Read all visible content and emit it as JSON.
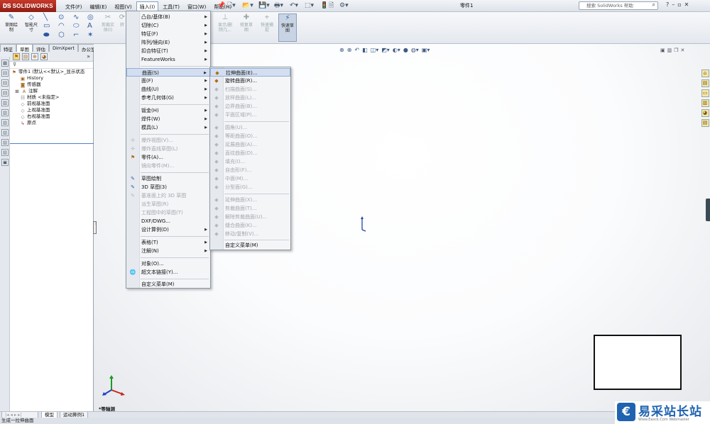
{
  "app": {
    "logo": "SOLIDWORKS",
    "document_title": "零件1"
  },
  "menubar": [
    "文件(F)",
    "编辑(E)",
    "视图(V)",
    "插入(I)",
    "工具(T)",
    "窗口(W)",
    "帮助(H)"
  ],
  "search": {
    "placeholder": "搜索 SolidWorks 帮助"
  },
  "cmd": {
    "sketch": "草图绘\n制",
    "smart_dim": "智能尺\n寸",
    "trim": "剪裁实\n体(I)",
    "convert": "转",
    "show_hide": "显示/删\n除几...",
    "repair": "修复草\n图",
    "quick_snap": "快速捕\n捉",
    "rapid_sketch": "快速草\n图"
  },
  "tabs": [
    "特征",
    "草图",
    "评估",
    "DimXpert",
    "办公室产品"
  ],
  "tree": {
    "root": "零件1 (默认<<默认>_显示状态",
    "items": [
      "History",
      "传感器",
      "注解",
      "材质 <未指定>",
      "前视基准面",
      "上视基准面",
      "右视基准面",
      "原点"
    ]
  },
  "insert_menu": [
    {
      "label": "凸台/基体(B)",
      "arrow": true
    },
    {
      "label": "切除(C)",
      "arrow": true
    },
    {
      "label": "特征(F)",
      "arrow": true
    },
    {
      "label": "阵列/镜向(E)",
      "arrow": true
    },
    {
      "label": "扣合特征(T)",
      "arrow": true
    },
    {
      "label": "FeatureWorks",
      "arrow": true
    },
    {
      "label": "曲面(S)",
      "arrow": true,
      "highlight": true
    },
    {
      "label": "面(F)",
      "arrow": true
    },
    {
      "label": "曲线(U)",
      "arrow": true
    },
    {
      "label": "参考几何体(G)",
      "arrow": true
    },
    {
      "label": "钣金(H)",
      "arrow": true
    },
    {
      "label": "焊件(W)",
      "arrow": true
    },
    {
      "label": "模具(L)",
      "arrow": true
    },
    {
      "label": "爆炸视图(V)...",
      "disabled": true
    },
    {
      "label": "爆炸直线草图(L)",
      "disabled": true
    },
    {
      "label": "零件(A)..."
    },
    {
      "label": "镜向零件(M)...",
      "disabled": true
    },
    {
      "label": "草图绘制"
    },
    {
      "label": "3D 草图(3)"
    },
    {
      "label": "基准面上的 3D 草图",
      "disabled": true
    },
    {
      "label": "派生草图(R)",
      "disabled": true
    },
    {
      "label": "工程图中的草图(T)",
      "disabled": true
    },
    {
      "label": "DXF/DWG..."
    },
    {
      "label": "设计算例(D)",
      "arrow": true
    },
    {
      "label": "表格(T)",
      "arrow": true
    },
    {
      "label": "注解(N)",
      "arrow": true
    },
    {
      "label": "对象(O)..."
    },
    {
      "label": "超文本链接(Y)..."
    },
    {
      "label": "自定义菜单(M)"
    }
  ],
  "surface_menu": [
    {
      "label": "拉伸曲面(E)...",
      "highlight": true
    },
    {
      "label": "旋转曲面(R)..."
    },
    {
      "label": "扫描曲面(S)...",
      "disabled": true
    },
    {
      "label": "放样曲面(L)...",
      "disabled": true
    },
    {
      "label": "边界曲面(B)...",
      "disabled": true
    },
    {
      "label": "平面区域(P)...",
      "disabled": true
    },
    {
      "label": "圆角(U)...",
      "disabled": true
    },
    {
      "label": "等距曲面(O)...",
      "disabled": true
    },
    {
      "label": "延展曲面(A)...",
      "disabled": true
    },
    {
      "label": "直纹曲面(D)...",
      "disabled": true
    },
    {
      "label": "填充(I)...",
      "disabled": true
    },
    {
      "label": "自由形(F)...",
      "disabled": true
    },
    {
      "label": "中面(M)...",
      "disabled": true
    },
    {
      "label": "分型面(G)...",
      "disabled": true
    },
    {
      "label": "延伸曲面(X)...",
      "disabled": true
    },
    {
      "label": "剪裁曲面(T)...",
      "disabled": true
    },
    {
      "label": "解除剪裁曲面(U)...",
      "disabled": true
    },
    {
      "label": "缝合曲面(K)...",
      "disabled": true
    },
    {
      "label": "移动/复制(V)...",
      "disabled": true
    },
    {
      "label": "自定义菜单(M)"
    }
  ],
  "viewport": {
    "view_label": "*等轴测"
  },
  "bottom_tabs": [
    "模型",
    "运动算例1"
  ],
  "status": "生成一拉伸曲面",
  "watermark": {
    "text": "易采站长站",
    "sub": "Www.Easck.Com Webmaster"
  }
}
